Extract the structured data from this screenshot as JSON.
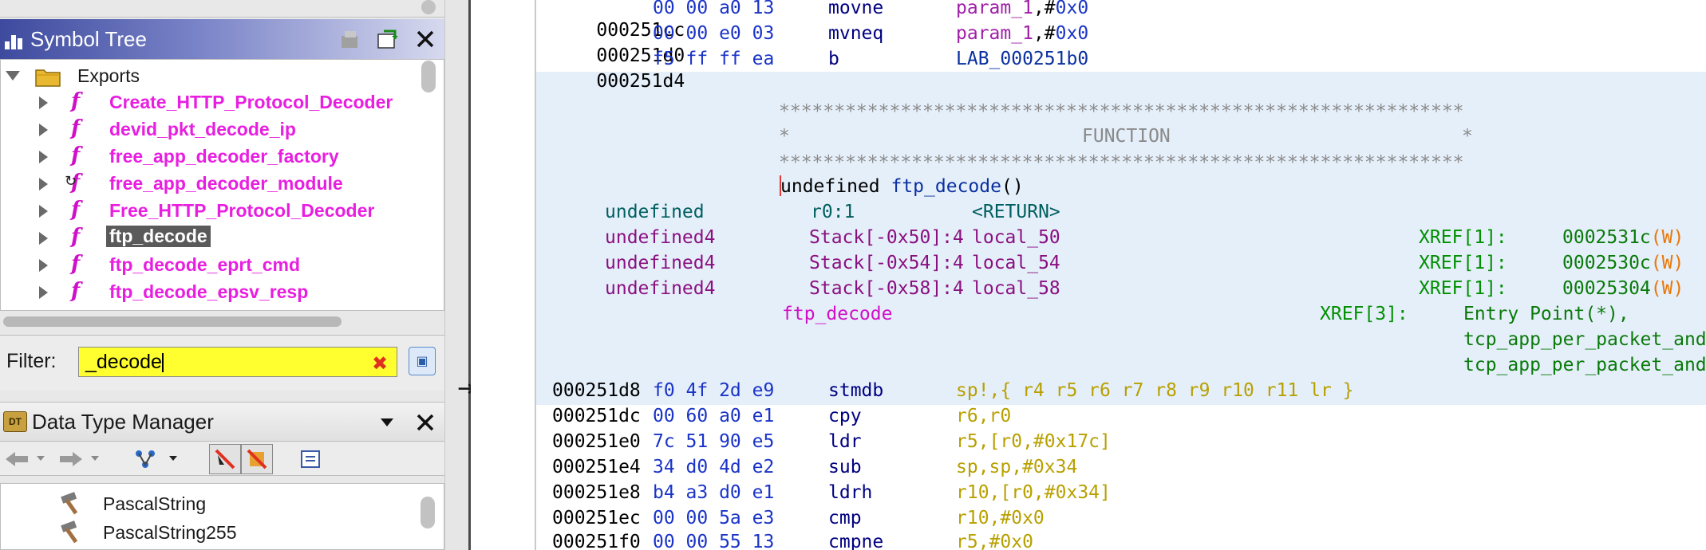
{
  "symbol_tree": {
    "title": "Symbol Tree",
    "root_label": "Exports",
    "items": [
      {
        "label": "Create_HTTP_Protocol_Decoder"
      },
      {
        "label": "devid_pkt_decode_ip"
      },
      {
        "label": "free_app_decoder_factory"
      },
      {
        "label": "free_app_decoder_module"
      },
      {
        "label": "Free_HTTP_Protocol_Decoder"
      },
      {
        "label": "ftp_decode"
      },
      {
        "label": "ftp_decode_eprt_cmd"
      },
      {
        "label": "ftp_decode_epsv_resp"
      }
    ],
    "selected": "ftp_decode"
  },
  "filter": {
    "label": "Filter:",
    "value": "_decode"
  },
  "data_type_manager": {
    "title": "Data Type Manager",
    "items": [
      {
        "label": "PascalString"
      },
      {
        "label": "PascalString255"
      }
    ]
  },
  "listing": {
    "top_lines": [
      {
        "addr": "000251cc",
        "bytes": "00 00 a0 13",
        "mnem": "movne",
        "op1": "param_1",
        "op2": ",#",
        "op3": "0x0"
      },
      {
        "addr": "000251d0",
        "bytes": "00 00 e0 03",
        "mnem": "mvneq",
        "op1": "param_1",
        "op2": ",#",
        "op3": "0x0"
      },
      {
        "addr": "000251d4",
        "bytes": "f5 ff ff ea",
        "mnem": "b",
        "op1": "LAB_000251b0",
        "op2": "",
        "op3": ""
      }
    ],
    "banner_stars": "**************************************************************",
    "banner_left": "*",
    "banner_title": "FUNCTION",
    "banner_right": "*",
    "signature": {
      "ret": "undefined",
      "name": "ftp_decode",
      "args": "()"
    },
    "vars": [
      {
        "type": "undefined",
        "storage": "r0:1",
        "name": "<RETURN>",
        "xref": "",
        "xref_addr": "",
        "xref_kind": ""
      },
      {
        "type": "undefined4",
        "storage": "Stack[-0x50]:4",
        "name": "local_50",
        "xref": "XREF[1]:",
        "xref_addr": "0002531c",
        "xref_kind": "(W)"
      },
      {
        "type": "undefined4",
        "storage": "Stack[-0x54]:4",
        "name": "local_54",
        "xref": "XREF[1]:",
        "xref_addr": "0002530c",
        "xref_kind": "(W)"
      },
      {
        "type": "undefined4",
        "storage": "Stack[-0x58]:4",
        "name": "local_58",
        "xref": "XREF[1]:",
        "xref_addr": "00025304",
        "xref_kind": "(W)"
      }
    ],
    "func_label": "ftp_decode",
    "func_xref": "XREF[3]:",
    "func_xrefs": [
      "Entry Point(*),",
      "tcp_app_per_packet_and",
      "tcp_app_per_packet_and"
    ],
    "body_lines": [
      {
        "addr": "000251d8",
        "bytes": "f0 4f 2d e9",
        "mnem": "stmdb",
        "ops": "sp!,{ r4 r5 r6 r7 r8 r9 r10 r11 lr }"
      },
      {
        "addr": "000251dc",
        "bytes": "00 60 a0 e1",
        "mnem": "cpy",
        "ops": "r6,r0"
      },
      {
        "addr": "000251e0",
        "bytes": "7c 51 90 e5",
        "mnem": "ldr",
        "ops": "r5,[r0,#0x17c]"
      },
      {
        "addr": "000251e4",
        "bytes": "34 d0 4d e2",
        "mnem": "sub",
        "ops": "sp,sp,#0x34"
      },
      {
        "addr": "000251e8",
        "bytes": "b4 a3 d0 e1",
        "mnem": "ldrh",
        "ops": "r10,[r0,#0x34]"
      },
      {
        "addr": "000251ec",
        "bytes": "00 00 5a e3",
        "mnem": "cmp",
        "ops": "r10,#0x0"
      },
      {
        "addr": "000251f0",
        "bytes": "00 00 55 13",
        "mnem": "cmpne",
        "ops": "r5,#0x0"
      }
    ]
  },
  "colors": {
    "selection_bg": "#5a5a5a",
    "function_name": "#e81ee0",
    "filter_bg": "#ffff30",
    "function_band": "#e5effa"
  }
}
